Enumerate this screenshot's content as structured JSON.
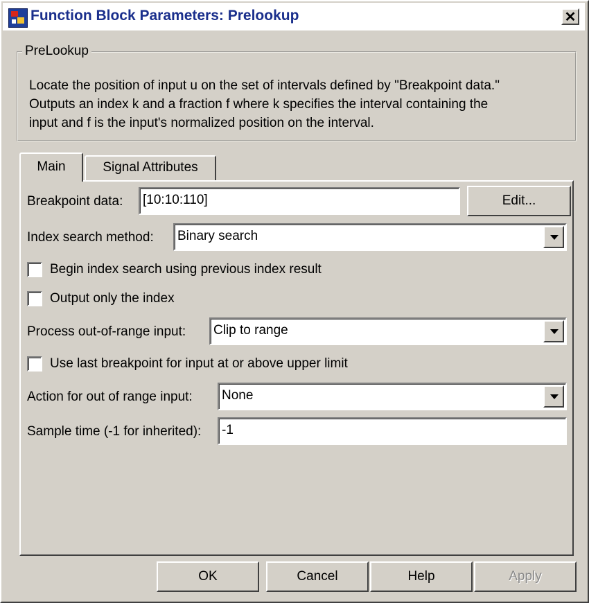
{
  "window": {
    "title": "Function Block Parameters: Prelookup",
    "close_symbol": "✕"
  },
  "group": {
    "label": "PreLookup",
    "description_lines": [
      "Locate the position of input u on the set of intervals defined by \"Breakpoint data.\"",
      "Outputs an index k and a fraction f where k specifies the interval containing the",
      "input and f is the input's normalized position on the interval."
    ]
  },
  "tabs": [
    {
      "label": "Main",
      "selected": true
    },
    {
      "label": "Signal Attributes",
      "selected": false
    }
  ],
  "main": {
    "breakpoint": {
      "label": "Breakpoint data:",
      "value": "[10:10:110]",
      "edit_label": "Edit..."
    },
    "index_search": {
      "label": "Index search method:",
      "value": "Binary search"
    },
    "begin_index_search": {
      "label": "Begin index search using previous index result",
      "checked": false
    },
    "output_only_index": {
      "label": "Output only the index",
      "checked": false
    },
    "process_oor": {
      "label": "Process out-of-range input:",
      "value": "Clip to range"
    },
    "use_last_breakpoint": {
      "label": "Use last breakpoint for input at or above upper limit",
      "checked": false
    },
    "action_oor": {
      "label": "Action for out of range input:",
      "value": "None"
    },
    "sample_time": {
      "label": "Sample time (-1 for inherited):",
      "value": "-1"
    }
  },
  "buttons": {
    "ok": "OK",
    "cancel": "Cancel",
    "help": "Help",
    "apply": "Apply"
  },
  "colors": {
    "dialog_bg": "#d4d0c8",
    "title_text": "#1a2f8c",
    "disabled_text": "#8a8a8a"
  }
}
